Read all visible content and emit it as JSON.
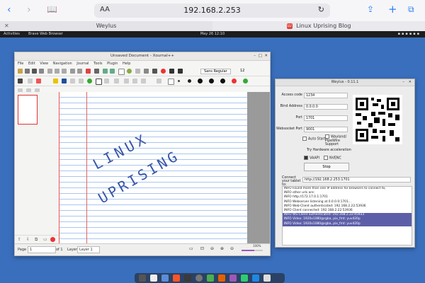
{
  "safari": {
    "url_prefix": "AA",
    "url": "192.168.2.253",
    "tabs": [
      {
        "label": "Weylus"
      },
      {
        "label": "Linux Uprising Blog",
        "favicon": "LU"
      }
    ]
  },
  "gnome": {
    "activities": "Activities",
    "app": "Brave Web Browser",
    "clock": "May 26 12:10"
  },
  "xournal": {
    "title": "Unsaved Document - Xournal++",
    "menu": [
      "File",
      "Edit",
      "View",
      "Navigation",
      "Journal",
      "Tools",
      "Plugin",
      "Help"
    ],
    "font": "Sans Regular",
    "font_size": "12",
    "handwriting": [
      "LINUX",
      "UPRISING"
    ],
    "status": {
      "page_label": "Page",
      "page_value": "1",
      "of": "of 1",
      "layer_label": "Layer",
      "layer_value": "Layer 1",
      "zoom": "100%"
    }
  },
  "weylus": {
    "title": "Weylus - 0.11.1",
    "access_code_label": "Access code",
    "access_code": "1234",
    "bind_label": "Bind Address",
    "bind": "0.0.0.0",
    "port_label": "Port",
    "port": "1701",
    "ws_label": "Websocket Port",
    "ws": "9001",
    "auto_start": "Auto Start",
    "wayland": "Wayland/ PipeWire Support",
    "hw_accel": "Try Hardware acceleration",
    "vaapi": "VAAPI",
    "nvenc": "NVENC",
    "stop": "Stop",
    "connect_label": "Connect your tablet to:",
    "connect_url": "http://192.168.2.253:1701",
    "log": [
      "INFO Found more than one IP address for browsers to connect to,",
      "INFO other urls are:",
      "INFO http://172.17.0.1:1701",
      "INFO Webserver listening at 0.0.0.0:1701...",
      "INFO Web-Client authenticated: 192.168.2.22:53936",
      "INFO Client connected: 192.168.2.22:53936",
      "INFO WS-Client authenticated: 192.168.2.22:45933",
      "INFO Video: 1920x1080@rgba, pix_fmt: yuv420p",
      "INFO Video: 1920x1080@rgba, pix_fmt: yuv420p"
    ]
  },
  "colors": {
    "accent": "#2f7cf6",
    "desktop": "#3a6fbd",
    "selection": "#5c5fa8"
  }
}
